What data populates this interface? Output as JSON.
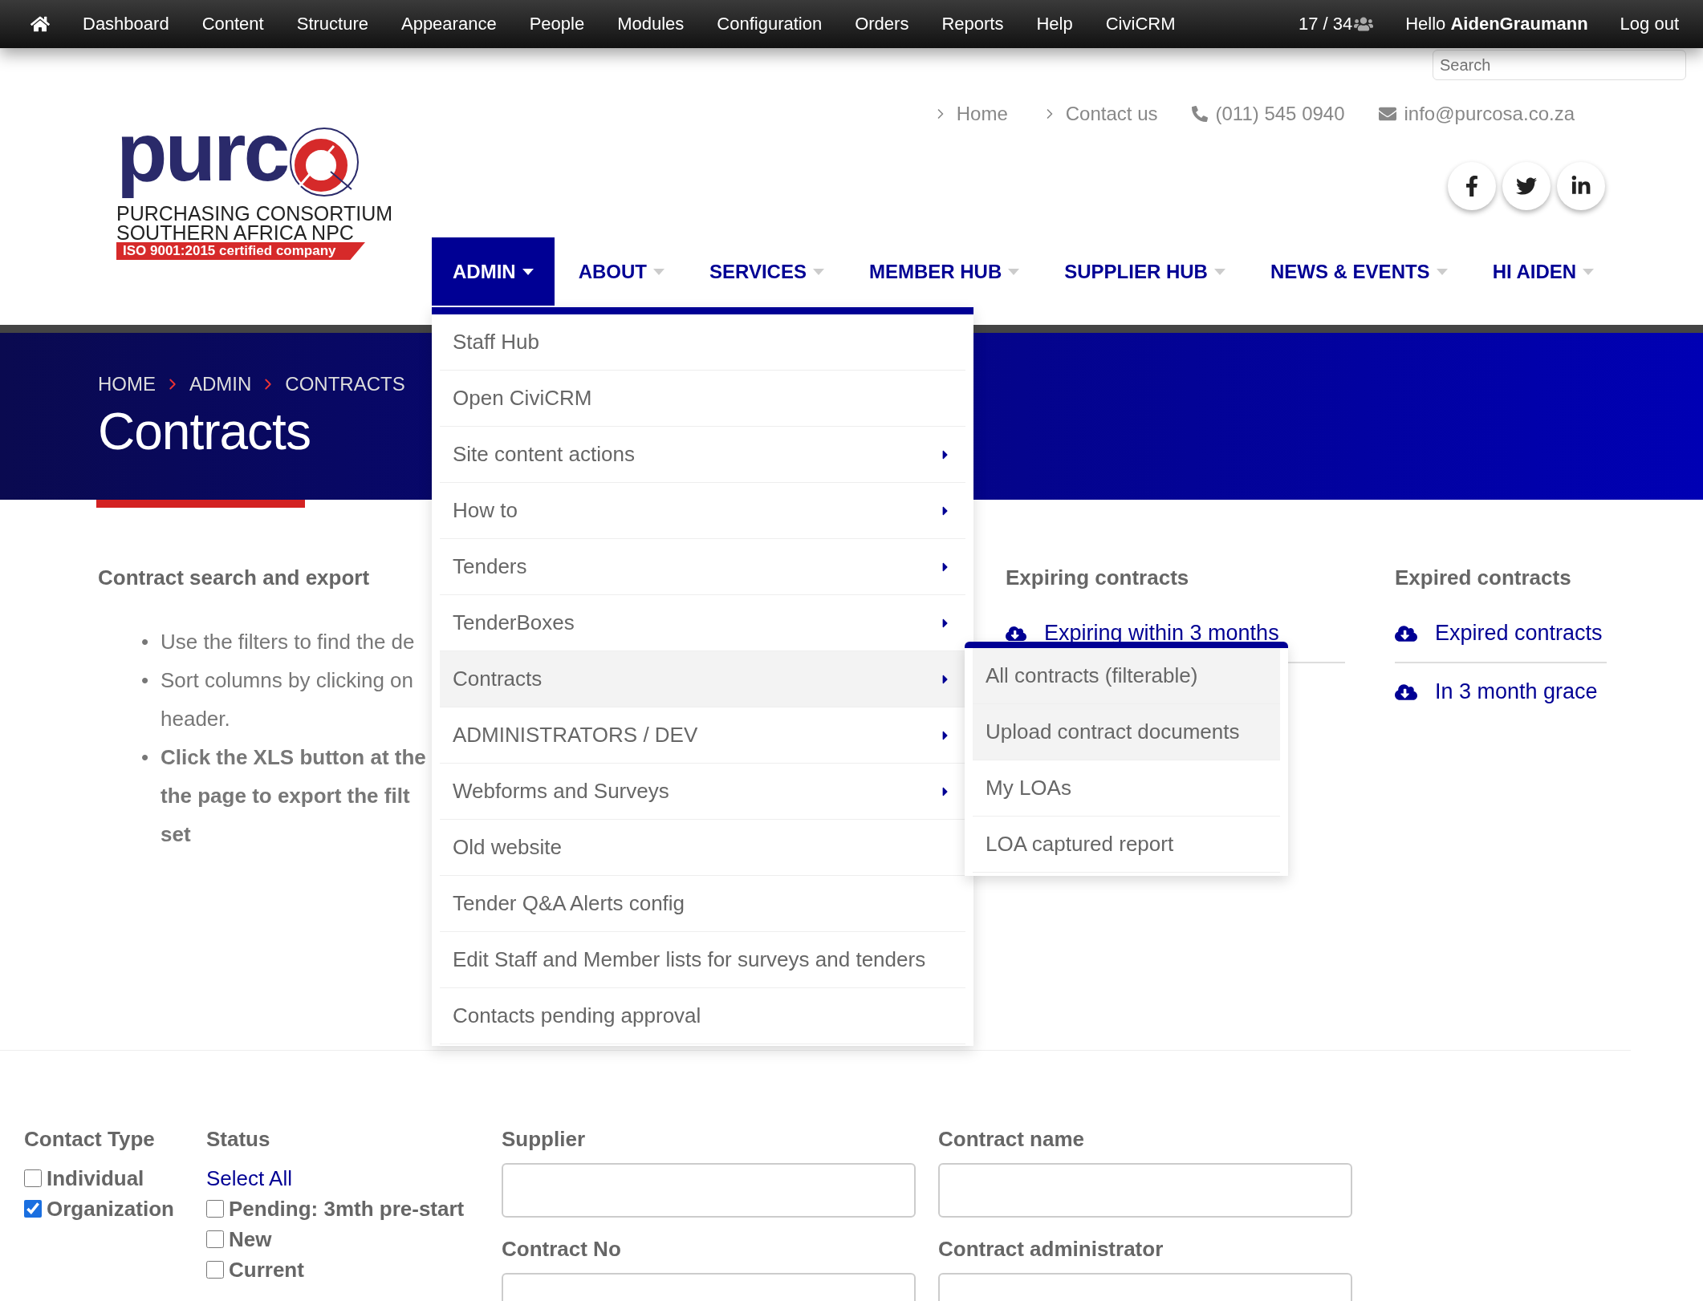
{
  "admin_bar": {
    "items": [
      "Dashboard",
      "Content",
      "Structure",
      "Appearance",
      "People",
      "Modules",
      "Configuration",
      "Orders",
      "Reports",
      "Help",
      "CiviCRM"
    ],
    "counter": "17 / 34",
    "greeting": "Hello",
    "user": "AidenGraumann",
    "logout": "Log out",
    "search": {
      "placeholder": "Search"
    }
  },
  "logo": {
    "wordmark": "purc",
    "line1": "PURCHASING CONSORTIUM",
    "line2": "SOUTHERN AFRICA NPC",
    "badge": "ISO 9001:2015 certified company"
  },
  "top_links": [
    {
      "kind": "link",
      "text": "Home"
    },
    {
      "kind": "link",
      "text": "Contact us"
    },
    {
      "kind": "phone",
      "text": "(011) 545 0940"
    },
    {
      "kind": "email",
      "text": "info@purcosa.co.za"
    }
  ],
  "social": [
    {
      "kind": "facebook"
    },
    {
      "kind": "twitter"
    },
    {
      "kind": "linkedin"
    }
  ],
  "nav": [
    {
      "label": "ADMIN",
      "selected": true
    },
    {
      "label": "ABOUT",
      "selected": false
    },
    {
      "label": "SERVICES",
      "selected": false
    },
    {
      "label": "MEMBER HUB",
      "selected": false
    },
    {
      "label": "SUPPLIER HUB",
      "selected": false
    },
    {
      "label": "NEWS & EVENTS",
      "selected": false
    },
    {
      "label": "HI AIDEN",
      "selected": false
    }
  ],
  "menu": [
    {
      "label": "Staff Hub",
      "submenu": false,
      "selected": false
    },
    {
      "label": "Open CiviCRM",
      "submenu": false,
      "selected": false
    },
    {
      "label": "Site content actions",
      "submenu": true,
      "selected": false
    },
    {
      "label": "How to",
      "submenu": true,
      "selected": false
    },
    {
      "label": "Tenders",
      "submenu": true,
      "selected": false
    },
    {
      "label": "TenderBoxes",
      "submenu": true,
      "selected": false
    },
    {
      "label": "Contracts",
      "submenu": true,
      "selected": true
    },
    {
      "label": "ADMINISTRATORS / DEV",
      "submenu": true,
      "selected": false
    },
    {
      "label": "Webforms and Surveys",
      "submenu": true,
      "selected": false
    },
    {
      "label": "Old website",
      "submenu": false,
      "selected": false
    },
    {
      "label": "Tender Q&A Alerts config",
      "submenu": false,
      "selected": false
    },
    {
      "label": "Edit Staff and Member lists for surveys and tenders",
      "submenu": false,
      "selected": false
    },
    {
      "label": "Contacts pending approval",
      "submenu": false,
      "selected": false
    }
  ],
  "submenu": [
    {
      "label": "All contracts (filterable)",
      "selected": true
    },
    {
      "label": "Upload contract documents",
      "selected": true
    },
    {
      "label": "My LOAs",
      "selected": false
    },
    {
      "label": "LOA captured report",
      "selected": false
    }
  ],
  "breadcrumb": [
    "HOME",
    "ADMIN",
    "CONTRACTS"
  ],
  "title": "Contracts",
  "intro": {
    "heading": "Contract search and export",
    "marker": "•",
    "bullets": [
      {
        "bold": false,
        "lines": [
          "Use the filters to find the de"
        ]
      },
      {
        "bold": false,
        "lines": [
          "Sort columns by clicking on",
          "header."
        ]
      },
      {
        "bold": true,
        "lines": [
          "Click the XLS button at the",
          "the page to export the filt",
          "set"
        ]
      }
    ]
  },
  "expiring": {
    "heading": "Expiring contracts",
    "links": [
      "Expiring within 3 months"
    ]
  },
  "expired": {
    "heading": "Expired contracts",
    "links": [
      "Expired contracts",
      "In 3 month grace"
    ]
  },
  "filters": {
    "contact_type": {
      "label": "Contact Type",
      "options": [
        {
          "label": "Individual",
          "checked": false
        },
        {
          "label": "Organization",
          "checked": true
        }
      ]
    },
    "status": {
      "label": "Status",
      "select_all": "Select All",
      "options": [
        {
          "label": "Pending: 3mth pre-start",
          "checked": false
        },
        {
          "label": "New",
          "checked": false
        },
        {
          "label": "Current",
          "checked": false
        }
      ]
    },
    "fields": [
      {
        "label": "Supplier"
      },
      {
        "label": "Contract name"
      },
      {
        "label": "Contract No"
      },
      {
        "label": "Contract administrator"
      }
    ]
  }
}
